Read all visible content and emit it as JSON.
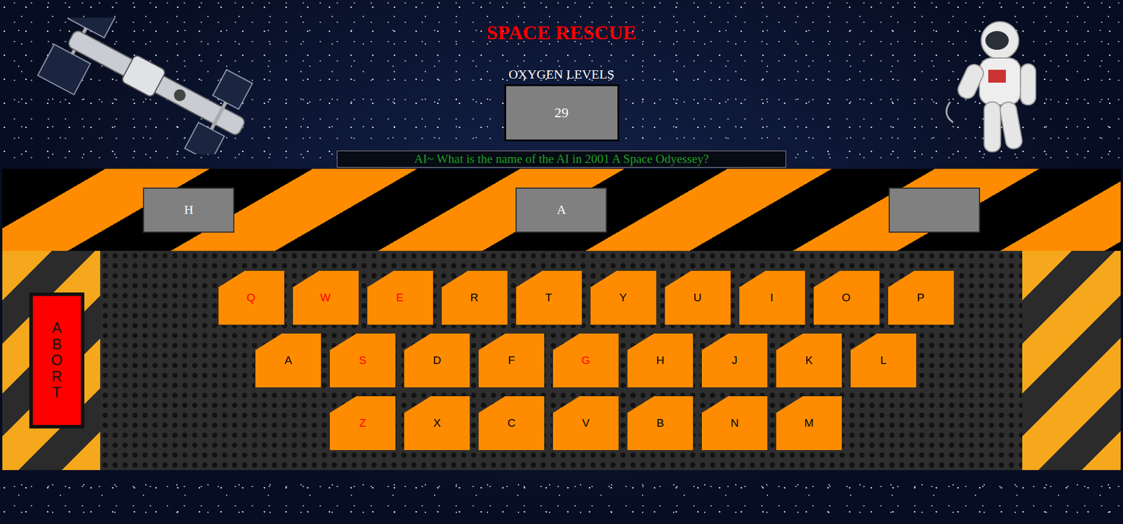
{
  "title": "SPACE RESCUE",
  "oxygen": {
    "label": "OXYGEN LEVELS",
    "value": "29"
  },
  "question": "AI~ What is the name of the AI in 2001 A Space Odyessey?",
  "answer_slots": [
    {
      "letter": "H"
    },
    {
      "letter": "A"
    },
    {
      "letter": ""
    }
  ],
  "abort_button": "ABORT",
  "keyboard": {
    "rows": [
      [
        {
          "key": "Q",
          "wrong": true
        },
        {
          "key": "W",
          "wrong": true
        },
        {
          "key": "E",
          "wrong": true
        },
        {
          "key": "R",
          "wrong": false
        },
        {
          "key": "T",
          "wrong": false
        },
        {
          "key": "Y",
          "wrong": false
        },
        {
          "key": "U",
          "wrong": false
        },
        {
          "key": "I",
          "wrong": false
        },
        {
          "key": "O",
          "wrong": false
        },
        {
          "key": "P",
          "wrong": false
        }
      ],
      [
        {
          "key": "A",
          "wrong": false
        },
        {
          "key": "S",
          "wrong": true
        },
        {
          "key": "D",
          "wrong": false
        },
        {
          "key": "F",
          "wrong": false
        },
        {
          "key": "G",
          "wrong": true
        },
        {
          "key": "H",
          "wrong": false
        },
        {
          "key": "J",
          "wrong": false
        },
        {
          "key": "K",
          "wrong": false
        },
        {
          "key": "L",
          "wrong": false
        }
      ],
      [
        {
          "key": "Z",
          "wrong": true
        },
        {
          "key": "X",
          "wrong": false
        },
        {
          "key": "C",
          "wrong": false
        },
        {
          "key": "V",
          "wrong": false
        },
        {
          "key": "B",
          "wrong": false
        },
        {
          "key": "N",
          "wrong": false
        },
        {
          "key": "M",
          "wrong": false
        }
      ]
    ]
  }
}
